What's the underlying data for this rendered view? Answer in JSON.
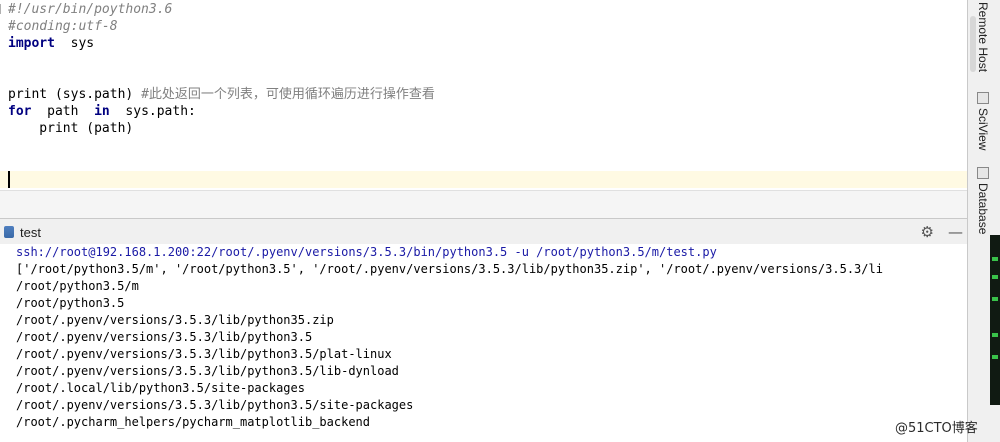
{
  "editor": {
    "lines": [
      {
        "text": "#!/usr/bin/poython3.6"
      },
      {
        "text": "#conding:utf-8"
      },
      {
        "kw": "import",
        "rest": "  sys"
      },
      {
        "text": ""
      },
      {
        "text": ""
      },
      {
        "code": "print (sys.path) ",
        "comment": "#此处返回一个列表，可使用循环遍历进行操作查看"
      },
      {
        "kw": "for",
        "mid": "  path  ",
        "kw2": "in",
        "rest": "  sys.path:"
      },
      {
        "code": "    print (path)"
      }
    ]
  },
  "run": {
    "tab_label": "test",
    "tools": {
      "settings": "⚙",
      "minimize": "—"
    }
  },
  "console": {
    "command": "ssh://root@192.168.1.200:22/root/.pyenv/versions/3.5.3/bin/python3.5 -u /root/python3.5/m/test.py",
    "output": [
      "['/root/python3.5/m', '/root/python3.5', '/root/.pyenv/versions/3.5.3/lib/python35.zip', '/root/.pyenv/versions/3.5.3/li",
      "/root/python3.5/m",
      "/root/python3.5",
      "/root/.pyenv/versions/3.5.3/lib/python35.zip",
      "/root/.pyenv/versions/3.5.3/lib/python3.5",
      "/root/.pyenv/versions/3.5.3/lib/python3.5/plat-linux",
      "/root/.pyenv/versions/3.5.3/lib/python3.5/lib-dynload",
      "/root/.local/lib/python3.5/site-packages",
      "/root/.pyenv/versions/3.5.3/lib/python3.5/site-packages",
      "/root/.pycharm_helpers/pycharm_matplotlib_backend"
    ]
  },
  "sidebar": {
    "tabs": [
      "Remote Host",
      "SciView",
      "Database"
    ]
  },
  "watermark": "@51CTO博客",
  "colors": {
    "keyword": "#000080",
    "comment": "#808080",
    "caret_line": "#fffae3",
    "console_command": "#1a1aa6"
  }
}
